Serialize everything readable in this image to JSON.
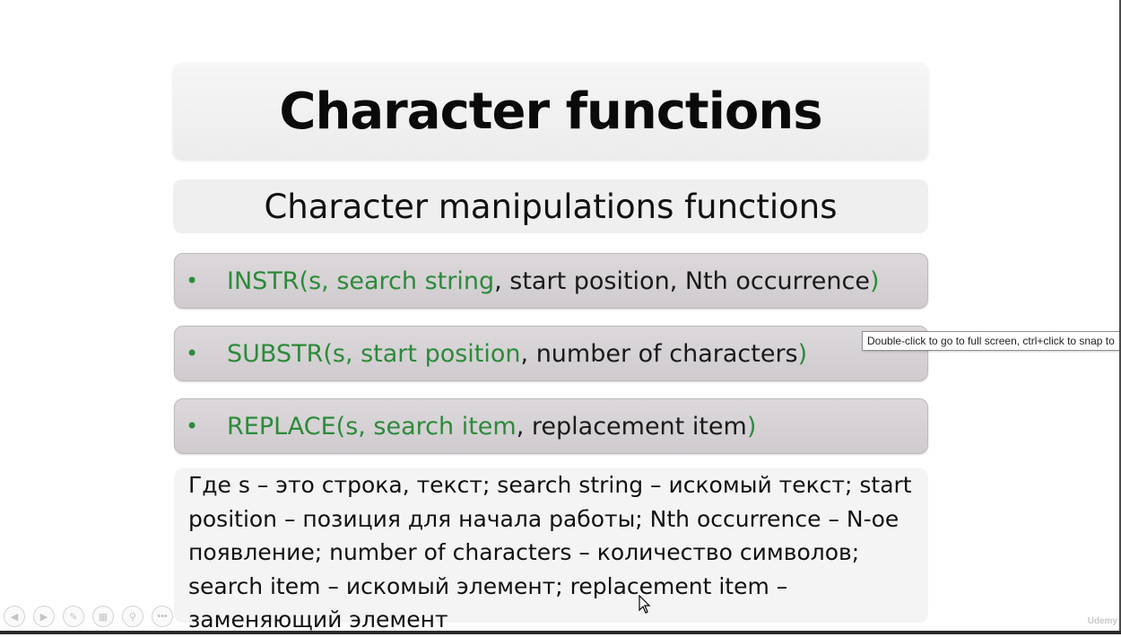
{
  "slide": {
    "title": "Character functions",
    "subtitle": "Character manipulations functions",
    "functions": [
      {
        "name_args": "INSTR(s, search string",
        "rest": ", start position, Nth occurrence",
        "close": ")"
      },
      {
        "name_args": "SUBSTR(s, start position",
        "rest": ", number of characters",
        "close": ")"
      },
      {
        "name_args": "REPLACE(s, search item",
        "rest": ", replacement item",
        "close": ")"
      }
    ],
    "note_lines": [
      "Где s – это строка, текст; search string – искомый текст; start",
      "position – позиция для начала работы; Nth occurrence – N-ое",
      "появление; number of characters – количество символов;",
      "search item – искомый элемент; replacement item –",
      "заменяющий элемент"
    ],
    "bullet": "•"
  },
  "tooltip": {
    "text": "Double-click to go to full screen, ctrl+click to snap to"
  },
  "controls": [
    {
      "icon": "previous-icon",
      "glyph": "◀"
    },
    {
      "icon": "next-icon",
      "glyph": "▶"
    },
    {
      "icon": "pen-icon",
      "glyph": "✎"
    },
    {
      "icon": "slides-grid-icon",
      "glyph": "▦"
    },
    {
      "icon": "zoom-icon",
      "glyph": "⚲"
    },
    {
      "icon": "more-options-icon",
      "glyph": "•••"
    }
  ],
  "watermark": "Udemy",
  "colors": {
    "function_green": "#2c8a3a",
    "box_gray": "#d6d2d5",
    "title_bg": "#f2f2f2"
  }
}
